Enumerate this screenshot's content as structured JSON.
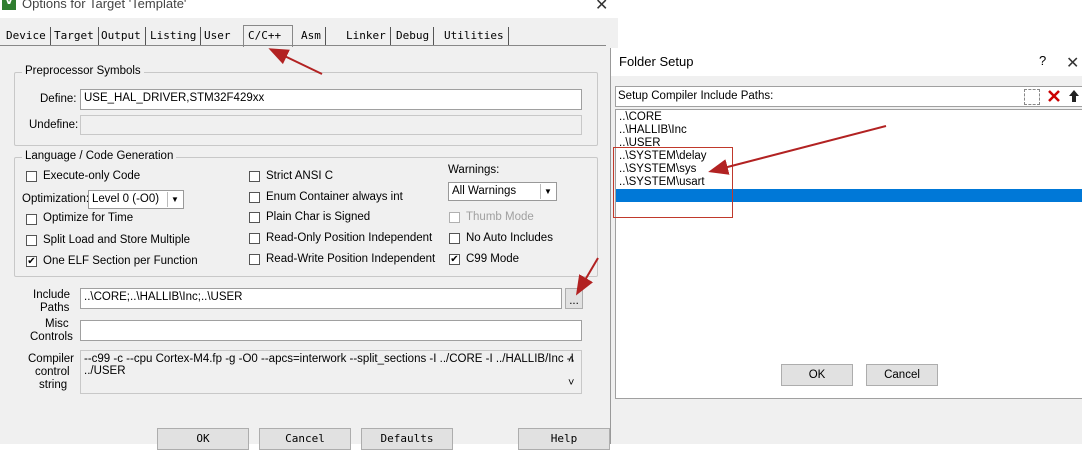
{
  "main": {
    "title": "Options for Target 'Template'",
    "close": "✕",
    "tabs": [
      "Device",
      "Target",
      "Output",
      "Listing",
      "User",
      "C/C++",
      "Asm",
      "Linker",
      "Debug",
      "Utilities"
    ],
    "preprocessor": {
      "group_title": "Preprocessor Symbols",
      "define_label": "Define:",
      "define_value": "USE_HAL_DRIVER,STM32F429xx",
      "undefine_label": "Undefine:",
      "undefine_value": ""
    },
    "language": {
      "group_title": "Language / Code Generation",
      "execute_only": "Execute-only Code",
      "optimization_label": "Optimization:",
      "optimization_value": "Level 0 (-O0)",
      "optimize_time": "Optimize for Time",
      "split_load": "Split Load and Store Multiple",
      "one_elf": "One ELF Section per Function",
      "strict_ansi": "Strict ANSI C",
      "enum_container": "Enum Container always int",
      "plain_char": "Plain Char is Signed",
      "ro_position": "Read-Only Position Independent",
      "rw_position": "Read-Write Position Independent",
      "warnings_label": "Warnings:",
      "warnings_value": "All Warnings",
      "thumb_mode": "Thumb Mode",
      "no_auto_includes": "No Auto Includes",
      "c99_mode": "C99 Mode",
      "check": "✔"
    },
    "include_label_1": "Include",
    "include_label_2": "Paths",
    "include_value": "..\\CORE;..\\HALLIB\\Inc;..\\USER",
    "browse": "...",
    "misc_label_1": "Misc",
    "misc_label_2": "Controls",
    "misc_value": "",
    "compiler_label_1": "Compiler",
    "compiler_label_2": "control",
    "compiler_label_3": "string",
    "compiler_line_1": "--c99 -c --cpu Cortex-M4.fp -g -O0 --apcs=interwork --split_sections -I ../CORE -I ../HALLIB/Inc -I",
    "compiler_line_2": "../USER",
    "scroll_up": "˄",
    "scroll_down": "˅",
    "buttons": {
      "ok": "OK",
      "cancel": "Cancel",
      "defaults": "Defaults",
      "help": "Help"
    }
  },
  "folder": {
    "title": "Folder Setup",
    "help": "?",
    "close": "✕",
    "heading": "Setup Compiler Include Paths:",
    "paths": [
      "..\\CORE",
      "..\\HALLIB\\Inc",
      "..\\USER",
      "..\\SYSTEM\\delay",
      "..\\SYSTEM\\sys",
      "..\\SYSTEM\\usart"
    ],
    "ok": "OK",
    "cancel": "Cancel"
  },
  "colors": {
    "annotation": "#b22222",
    "selection": "#0078d7",
    "highlight_box": "#c0392b"
  }
}
